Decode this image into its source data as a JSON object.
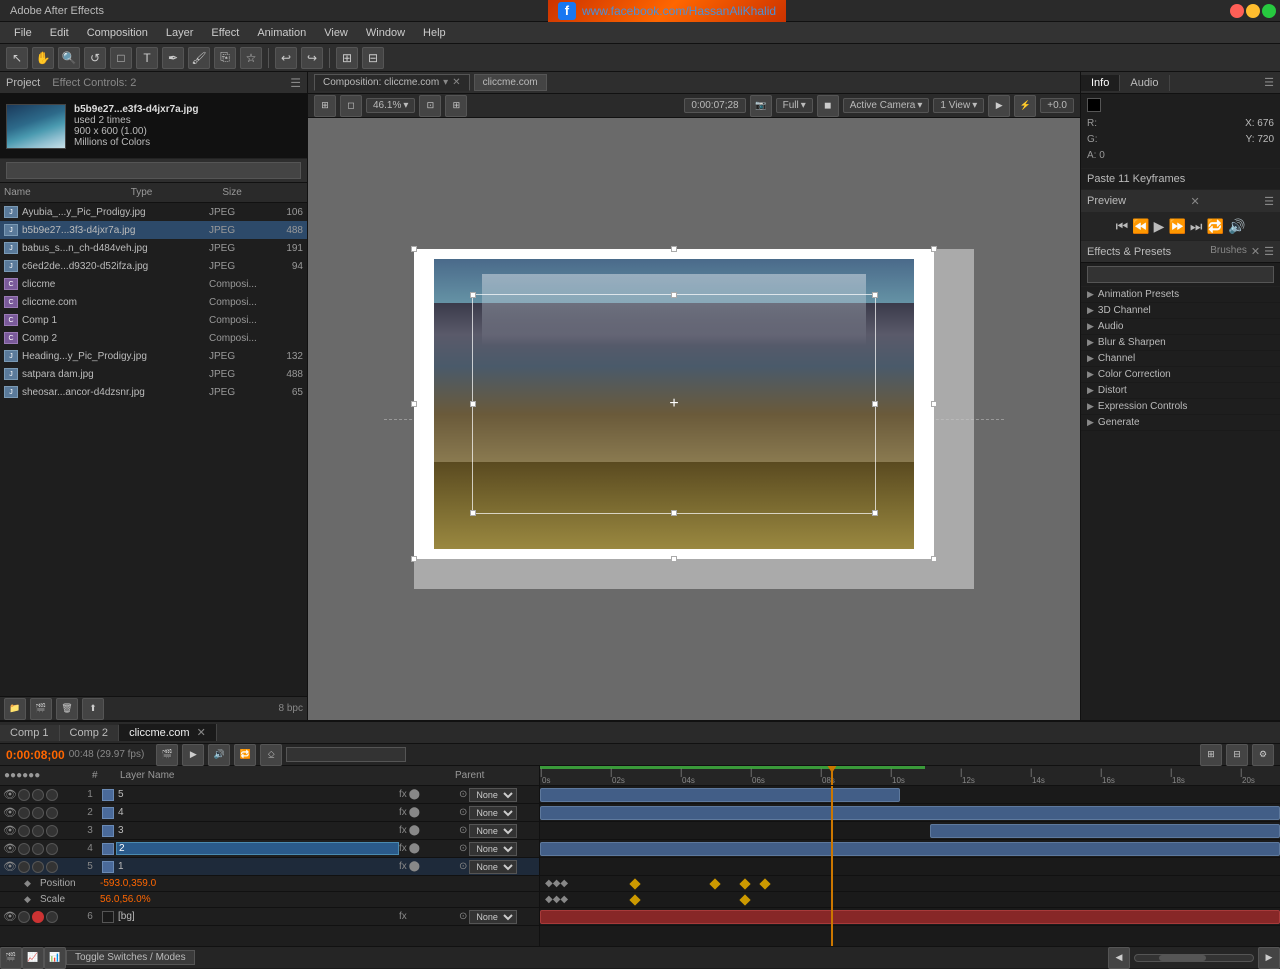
{
  "app": {
    "title": "Adobe After Effects",
    "fb_url": "www.facebook.com/HassanAliKhalid"
  },
  "menu": {
    "items": [
      "File",
      "Edit",
      "Composition",
      "Layer",
      "Effect",
      "Animation",
      "View",
      "Window",
      "Help"
    ]
  },
  "project": {
    "header": "Project",
    "effect_controls": "Effect Controls: 2",
    "search_placeholder": "🔍",
    "thumbnail": {
      "filename": "b5b9e27...e3f3-d4jxr7a.jpg",
      "used": "used 2 times",
      "dimensions": "900 x 600 (1.00)",
      "color_mode": "Millions of Colors"
    },
    "columns": {
      "name": "Name",
      "type": "Type",
      "size": "Size"
    },
    "items": [
      {
        "name": "Ayubia_...y_Pic_Prodigy.jpg",
        "type": "JPEG",
        "size": "106",
        "icon": "jpeg"
      },
      {
        "name": "b5b9e27...3f3-d4jxr7a.jpg",
        "type": "JPEG",
        "size": "488",
        "icon": "jpeg",
        "selected": true
      },
      {
        "name": "babus_s...n_ch-d484veh.jpg",
        "type": "JPEG",
        "size": "191",
        "icon": "jpeg"
      },
      {
        "name": "c6ed2de...d9320-d52ifza.jpg",
        "type": "JPEG",
        "size": "94",
        "icon": "jpeg"
      },
      {
        "name": "cliccme",
        "type": "Composi...",
        "size": "",
        "icon": "comp"
      },
      {
        "name": "cliccme.com",
        "type": "Composi...",
        "size": "",
        "icon": "comp"
      },
      {
        "name": "Comp 1",
        "type": "Composi...",
        "size": "",
        "icon": "comp"
      },
      {
        "name": "Comp 2",
        "type": "Composi...",
        "size": "",
        "icon": "comp"
      },
      {
        "name": "Heading...y_Pic_Prodigy.jpg",
        "type": "JPEG",
        "size": "132",
        "icon": "jpeg"
      },
      {
        "name": "satpara dam.jpg",
        "type": "JPEG",
        "size": "488",
        "icon": "jpeg"
      },
      {
        "name": "sheosar...ancor-d4dzsnr.jpg",
        "type": "JPEG",
        "size": "65",
        "icon": "jpeg"
      }
    ],
    "bpc": "8 bpc"
  },
  "composition": {
    "tab_label": "Composition: cliccme.com",
    "breadcrumb": "cliccme.com",
    "zoom": "46.1%",
    "timecode": "0:00:07;28",
    "view_mode": "Full",
    "camera": "Active Camera",
    "views": "1 View",
    "offset": "+0.0"
  },
  "info": {
    "tab_info": "Info",
    "tab_audio": "Audio",
    "r_label": "R:",
    "g_label": "G:",
    "a_label": "A: 0",
    "x_label": "X: 676",
    "y_label": "Y: 720",
    "paste_keyframes": "Paste 11 Keyframes"
  },
  "preview": {
    "label": "Preview"
  },
  "effects": {
    "label": "Effects & Presets",
    "brushes": "Brushes",
    "search_placeholder": "🔍",
    "categories": [
      "Animation Presets",
      "3D Channel",
      "Audio",
      "Blur & Sharpen",
      "Channel",
      "Color Correction",
      "Distort",
      "Expression Controls",
      "Generate"
    ]
  },
  "timeline": {
    "comp1_tab": "Comp 1",
    "comp2_tab": "Comp 2",
    "active_tab": "cliccme.com",
    "timecode": "0:00:08;00",
    "fps": "00:48 (29.97 fps)",
    "search_placeholder": "🔍",
    "footer_label": "Toggle Switches / Modes",
    "layers": [
      {
        "num": "1",
        "vis": true,
        "name": "5",
        "type": "solid",
        "parent": "None"
      },
      {
        "num": "2",
        "vis": true,
        "name": "4",
        "type": "solid",
        "parent": "None"
      },
      {
        "num": "3",
        "vis": true,
        "name": "3",
        "type": "solid",
        "parent": "None"
      },
      {
        "num": "4",
        "vis": true,
        "name": "2",
        "type": "solid",
        "parent": "None",
        "editing": true
      },
      {
        "num": "5",
        "vis": true,
        "name": "1",
        "type": "solid",
        "parent": "None",
        "expanded": true
      },
      {
        "num": "6",
        "vis": true,
        "name": "[bg]",
        "type": "solid",
        "parent": "None",
        "red": true
      }
    ],
    "properties": [
      {
        "label": "Position",
        "value": "-593.0,359.0"
      },
      {
        "label": "Scale",
        "value": "56.0,56.0%"
      }
    ]
  }
}
